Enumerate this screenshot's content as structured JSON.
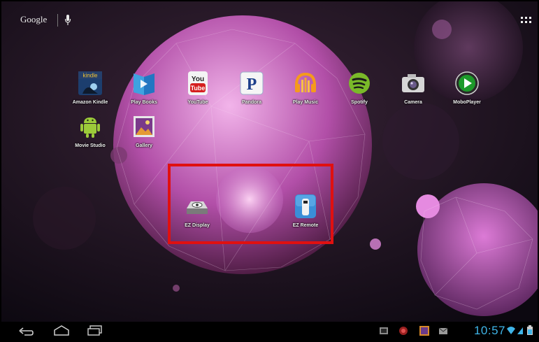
{
  "topbar": {
    "search_brand": "Google"
  },
  "home_apps": [
    {
      "label": "Amazon Kindle",
      "icon": "kindle-icon"
    },
    {
      "label": "Play Books",
      "icon": "play-books-icon"
    },
    {
      "label": "YouTube",
      "icon": "youtube-icon"
    },
    {
      "label": "Pandora",
      "icon": "pandora-icon"
    },
    {
      "label": "Play Music",
      "icon": "play-music-icon"
    },
    {
      "label": "Spotify",
      "icon": "spotify-icon"
    },
    {
      "label": "Camera",
      "icon": "camera-icon"
    },
    {
      "label": "MoboPlayer",
      "icon": "moboplayer-icon"
    },
    {
      "label": "Movie Studio",
      "icon": "movie-studio-icon"
    },
    {
      "label": "Gallery",
      "icon": "gallery-icon"
    },
    {
      "label": "EZ Display",
      "icon": "ez-display-icon"
    },
    {
      "label": "EZ Remote",
      "icon": "ez-remote-icon"
    }
  ],
  "statusbar": {
    "time": "10:57"
  },
  "colors": {
    "highlight": "#e01010",
    "clock": "#3fb5e8"
  }
}
